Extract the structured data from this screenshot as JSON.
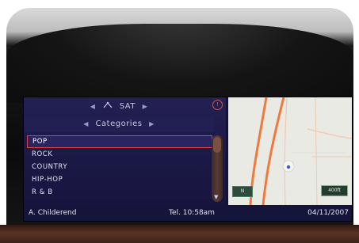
{
  "header": {
    "source_label": "SAT",
    "category_label": "Categories"
  },
  "categories": [
    {
      "label": "POP",
      "selected": true
    },
    {
      "label": "ROCK",
      "selected": false
    },
    {
      "label": "COUNTRY",
      "selected": false
    },
    {
      "label": "HIP-HOP",
      "selected": false
    },
    {
      "label": "R & B",
      "selected": false
    }
  ],
  "status": {
    "artist": "A. Childerend",
    "time": "Tel. 10:58am",
    "date": "04/11/2007"
  },
  "map": {
    "button_label": "N",
    "distance_label": "400ft"
  },
  "colors": {
    "screen_bg": "#1a1844",
    "selected_border": "#e04040",
    "route": "#f07a3c"
  }
}
